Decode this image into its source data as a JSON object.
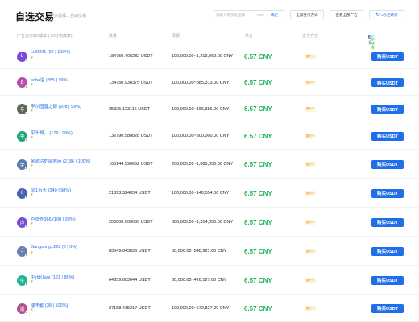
{
  "header": {
    "title": "自选交易",
    "subtitle": "更多选择、自由交易",
    "search_placeholder": "请输入购买总金额",
    "currency": "CNY",
    "confirm": "确定",
    "all_payments": "全部支付方式",
    "view_all_ads": "查看全部广告",
    "refresh": "3秒后刷新"
  },
  "columns": {
    "advertiser": "广告方(30日成单 | 30日完成率)",
    "quantity": "数量",
    "limit": "限额",
    "price": "单价",
    "payment": "支付方式",
    "trade": "交易",
    "fee_badge": "0手续费"
  },
  "rows": [
    {
      "initial": "L",
      "avatar_color": "#7b4bd6",
      "name": "LiJ0221 (96 | 100%)",
      "quantity": "184759.408282 USDT",
      "limit": "100,000.00~1,213,869.00 CNY",
      "price": "6.57 CNY",
      "payment": "银行卡",
      "action": "购买USDT"
    },
    {
      "initial": "E",
      "avatar_color": "#b54fb0",
      "name": "echo溢 (355 | 99%)",
      "quantity": "134750.930375 USDT",
      "limit": "100,000.00~885,313.00 CNY",
      "price": "6.57 CNY",
      "payment": "银行卡",
      "action": "购买USDT"
    },
    {
      "initial": "辛",
      "avatar_color": "#5b6b52",
      "name": "辛尔图普之即 (208 | 99%)",
      "quantity": "25325.123115 USDT",
      "limit": "100,000.00~166,386.00 CNY",
      "price": "6.57 CNY",
      "payment": "银行卡",
      "action": "购买USDT"
    },
    {
      "initial": "平",
      "avatar_color": "#22a37a",
      "name": "平头哥。 (179 | 98%)",
      "quantity": "132790.580828 USDT",
      "limit": "100,000.00~300,000.00 CNY",
      "price": "6.57 CNY",
      "payment": "银行卡",
      "action": "购买USDT"
    },
    {
      "initial": "金",
      "avatar_color": "#5b7bb5",
      "name": "金源活的康君商 (2186 | 100%)",
      "quantity": "165144.596652 USDT",
      "limit": "200,000.00~1,085,000.00 CNY",
      "price": "6.57 CNY",
      "payment": "银行卡",
      "action": "购买USDT"
    },
    {
      "initial": "6",
      "avatar_color": "#4e5fb8",
      "name": "661币火 (340 | 98%)",
      "quantity": "21393.324054 USDT",
      "limit": "100,000.00~140,554.00 CNY",
      "price": "6.57 CNY",
      "payment": "银行卡",
      "action": "购买USDT"
    },
    {
      "initial": "卢",
      "avatar_color": "#7b4bd6",
      "name": "卢员外366 (100 | 98%)",
      "quantity": "200000.000000 USDT",
      "limit": "300,000.00~1,314,000.00 CNY",
      "price": "6.57 CNY",
      "payment": "银行卡",
      "action": "购买USDT"
    },
    {
      "initial": "J",
      "avatar_color": "#6b7eb0",
      "name": "Jiangsong1222 (0 | 0%)",
      "quantity": "83549.643836 USDT",
      "limit": "50,000.00~548,921.00 CNY",
      "price": "6.57 CNY",
      "payment": "银行卡",
      "action": "购买USDT"
    },
    {
      "initial": "牛",
      "avatar_color": "#1fb58f",
      "name": "牛币Klass (121 | 86%)",
      "quantity": "64859.603044 USDT",
      "limit": "80,000.00~426,127.00 CNY",
      "price": "6.57 CNY",
      "payment": "银行卡",
      "action": "购买USDT"
    },
    {
      "initial": "潮",
      "avatar_color": "#b0508a",
      "name": "潮丰勤 (38 | 100%)",
      "quantity": "87188.415217 USDT",
      "limit": "100,000.00~572,827.00 CNY",
      "price": "6.57 CNY",
      "payment": "银行卡",
      "action": "购买USDT"
    }
  ]
}
